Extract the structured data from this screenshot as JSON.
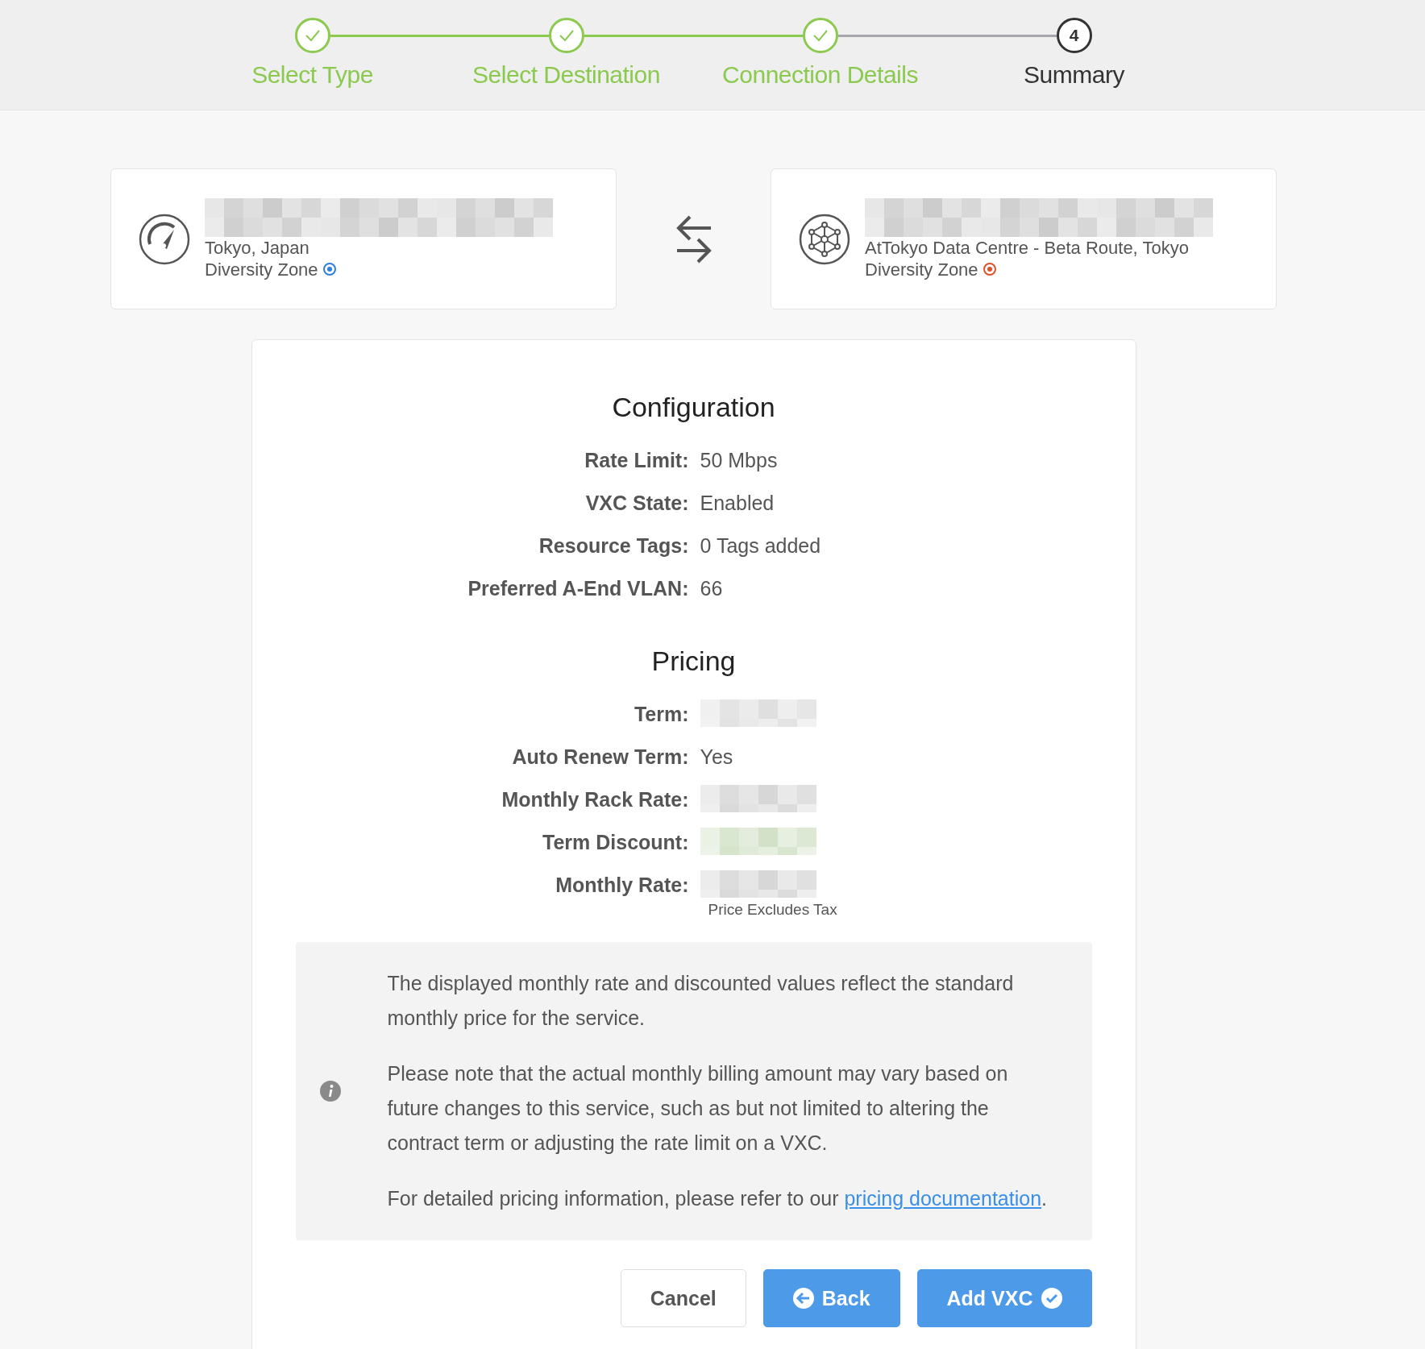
{
  "steps": [
    {
      "label": "Select Type",
      "completed": true,
      "selected": false
    },
    {
      "label": "Select Destination",
      "completed": true,
      "selected": false
    },
    {
      "label": "Connection Details",
      "completed": true,
      "selected": false
    },
    {
      "label": "Summary",
      "completed": false,
      "selected": true,
      "number": "4"
    }
  ],
  "endpoints": [
    {
      "kind": "gauge",
      "location": "Tokyo, Japan",
      "zone": "Diversity Zone",
      "color": "#2f7de1"
    },
    {
      "kind": "network",
      "location": "AtTokyo Data Centre - Beta Route, Tokyo",
      "zone": "Diversity Zone",
      "color": "#e0502a"
    }
  ],
  "sections": [
    {
      "title": "Configuration",
      "rows": [
        {
          "kind": "text",
          "label": "Rate Limit:",
          "value": "50 Mbps"
        },
        {
          "kind": "text",
          "label": "VXC State:",
          "value": "Enabled"
        },
        {
          "kind": "text",
          "label": "Resource Tags:",
          "value": "0 Tags added"
        },
        {
          "kind": "text",
          "label": "Preferred A-End VLAN:",
          "value": "66"
        }
      ]
    },
    {
      "title": "Pricing",
      "rows": [
        {
          "kind": "redacted",
          "label": "Term:",
          "color": "#dddddd"
        },
        {
          "kind": "text",
          "label": "Auto Renew Term:",
          "value": "Yes"
        },
        {
          "kind": "redacted",
          "label": "Monthly Rack Rate:",
          "color": "#d4d4d4"
        },
        {
          "kind": "redacted",
          "label": "Term Discount:",
          "color": "#cfdfc4"
        },
        {
          "kind": "redacted",
          "label": "Monthly Rate:",
          "color": "#d4d4d4",
          "note": "Price Excludes Tax"
        }
      ]
    }
  ],
  "notice": {
    "paragraphs": [
      "The displayed monthly rate and discounted values reflect the standard monthly price for the service.",
      "Please note that the actual monthly billing amount may vary based on future changes to this service, such as but not limited to altering the contract term or adjusting the rate limit on a VXC."
    ],
    "link_sentence": "For detailed pricing information, please refer to our",
    "link": "pricing documentation",
    "link_after": "."
  },
  "buttons": [
    {
      "kind": "secondary",
      "label": "Cancel"
    },
    {
      "kind": "back",
      "label": "Back"
    },
    {
      "kind": "confirm",
      "label": "Add VXC"
    }
  ]
}
